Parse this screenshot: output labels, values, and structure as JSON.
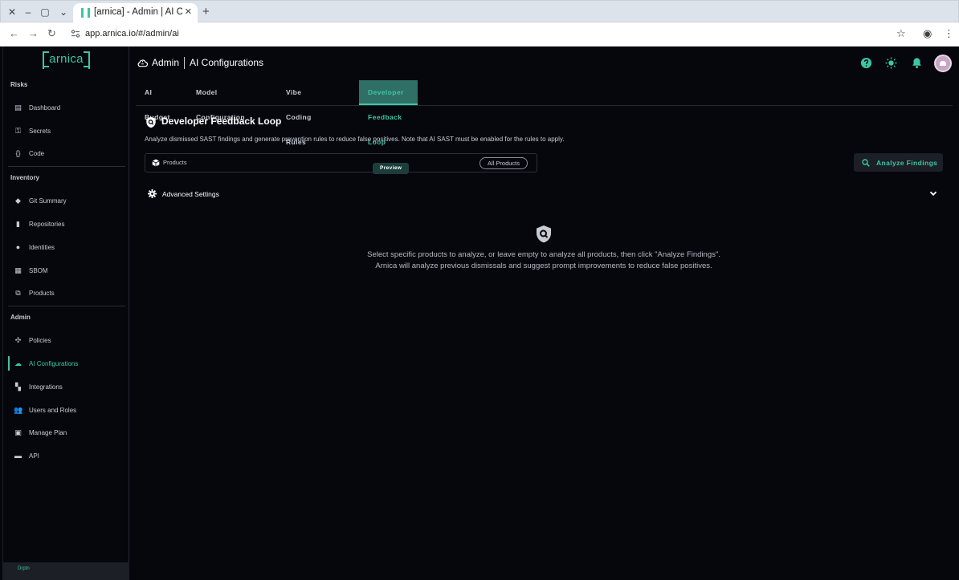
{
  "browser": {
    "tab_title": "[arnica] - Admin | AI C",
    "url": "app.arnica.io/#/admin/ai"
  },
  "sidebar": {
    "logo": "arnica",
    "sections": [
      {
        "label": "Risks",
        "items": [
          "Dashboard",
          "Secrets",
          "Code"
        ]
      },
      {
        "label": "Inventory",
        "items": [
          "Git Summary",
          "Repositories",
          "Identities",
          "SBOM",
          "Products"
        ]
      },
      {
        "label": "Admin",
        "items": [
          "Policies",
          "AI Configurations",
          "Integrations",
          "Users and Roles",
          "Manage Plan",
          "API"
        ]
      }
    ],
    "active_item": "AI Configurations",
    "footer": "Drptn"
  },
  "header": {
    "title": "Admin",
    "subtitle": "AI Configurations"
  },
  "tabs": [
    {
      "label": "AI Budget"
    },
    {
      "label": "Model Configuration"
    },
    {
      "label": "Vibe Coding Rules"
    },
    {
      "label": "Developer Feedback Loop",
      "badge": "Preview",
      "active": true
    }
  ],
  "section": {
    "title": "Developer Feedback Loop",
    "description": "Analyze dismissed SAST findings and generate prevention rules to reduce false positives. Note that AI SAST must be enabled for the rules to apply."
  },
  "products_filter": {
    "label": "Products",
    "chip": "All Products"
  },
  "analyze_button": "Analyze Findings",
  "advanced_settings": "Advanced Settings",
  "empty_state": {
    "line1": "Select specific products to analyze, or leave empty to analyze all products, then click \"Analyze Findings\".",
    "line2": "Arnica will analyze previous dismissals and suggest prompt improvements to reduce false positives."
  },
  "colors": {
    "accent": "#3cc6a5",
    "background": "#05070d",
    "active_tab_bg": "#2f6f66"
  }
}
